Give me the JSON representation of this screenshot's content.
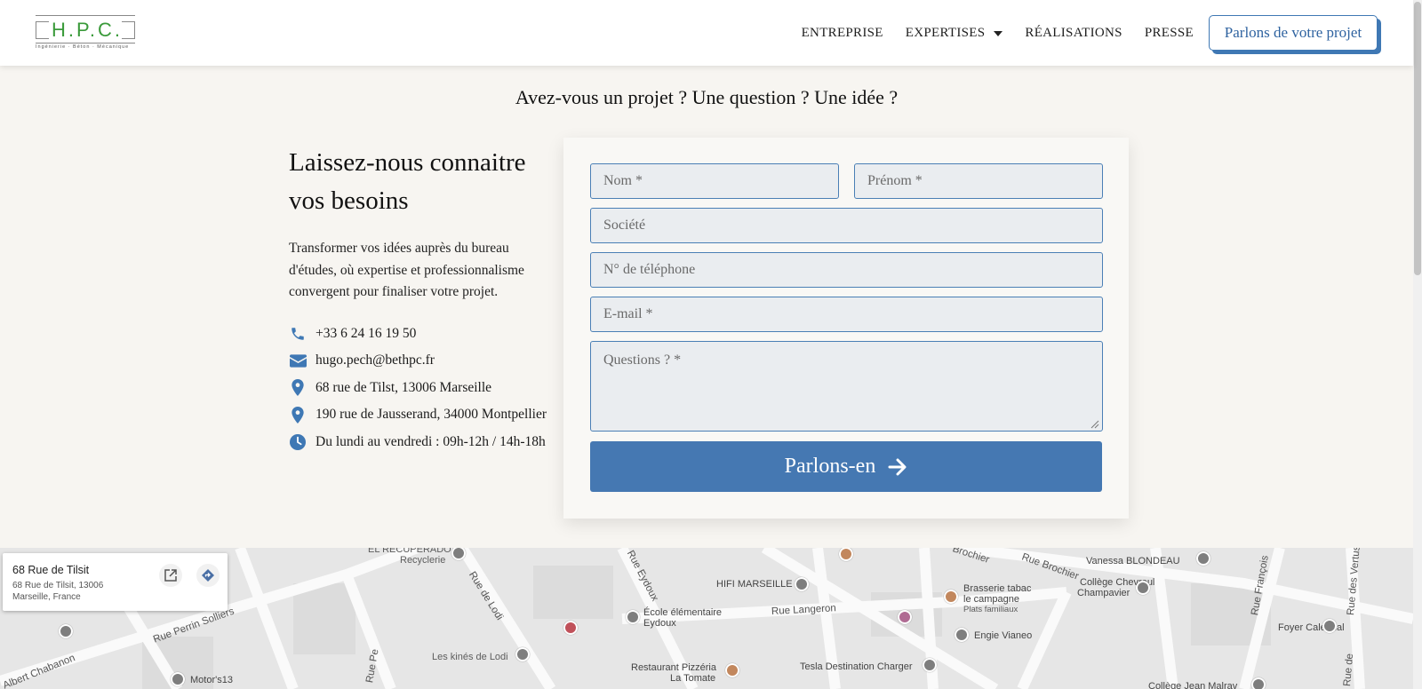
{
  "header": {
    "logo_text": "H.P.C.",
    "logo_tagline": "Ingénierie · Béton · Mécanique",
    "nav": [
      {
        "label": "ENTREPRISE"
      },
      {
        "label": "EXPERTISES"
      },
      {
        "label": "RÉALISATIONS"
      },
      {
        "label": "PRESSE"
      }
    ],
    "cta_label": "Parlons de votre projet"
  },
  "heading": "Avez-vous un projet ? Une question ? Une idée ?",
  "left": {
    "title_line1": "Laissez-nous connaitre",
    "title_line2": "vos besoins",
    "intro": "Transformer vos idées auprès du bureau d'études, où expertise et professionnalisme convergent pour finaliser votre projet.",
    "contacts": [
      {
        "icon": "phone-icon",
        "text": "+33 6 24 16 19 50"
      },
      {
        "icon": "envelope-icon",
        "text": "hugo.pech@bethpc.fr"
      },
      {
        "icon": "map-marker-icon",
        "text": "68 rue de Tilst, 13006 Marseille"
      },
      {
        "icon": "map-marker-icon",
        "text": "190 rue de Jausserand, 34000 Montpellier"
      },
      {
        "icon": "clock-icon",
        "text": "Du lundi au vendredi : 09h-12h / 14h-18h"
      }
    ]
  },
  "form": {
    "nom_placeholder": "Nom *",
    "prenom_placeholder": "Prénom *",
    "societe_placeholder": "Société",
    "phone_placeholder": "N° de téléphone",
    "email_placeholder": "E-mail *",
    "questions_placeholder": "Questions ? *",
    "submit_label": "Parlons-en"
  },
  "map": {
    "place_title": "68 Rue de Tilsit",
    "place_address": "68 Rue de Tilsit, 13006 Marseille, France",
    "labels": {
      "el_recuperado": "EL RECUPERADO",
      "recyclerie": "Recyclerie",
      "rue_de_lodi": "Rue de Lodi",
      "rue_eydoux": "Rue Eydoux",
      "hifi": "HIFI MARSEILLE",
      "rue_brochier": "Rue Brochier",
      "brochier": "Brochier",
      "vanessa": "Vanessa BLONDEAU",
      "rue_francois": "Rue François",
      "rue_des_vertus": "Rue des Vertus",
      "college": "Collège Chevreul",
      "champavier": "Champavier",
      "brasserie": "Brasserie tabac",
      "campagne": "le campagne",
      "plats": "Plats familiaux",
      "rue_perrin": "Rue Perrin Solliers",
      "albert": "Albert Chabanon",
      "rue_pe": "Rue Pe",
      "ecole": "École élémentaire",
      "eydoux": "Eydoux",
      "rue_langeron": "Rue Langeron",
      "engie": "Engie Vianeo",
      "foyer": "Foyer Calendal",
      "kines": "Les kinés de Lodi",
      "restaurant": "Restaurant Pizzéria",
      "tomate": "La Tomate",
      "tesla": "Tesla Destination Charger",
      "motors": "Motor's13",
      "college_jean": "Collège Jean Malrav",
      "rue_de": "Rue de"
    }
  }
}
